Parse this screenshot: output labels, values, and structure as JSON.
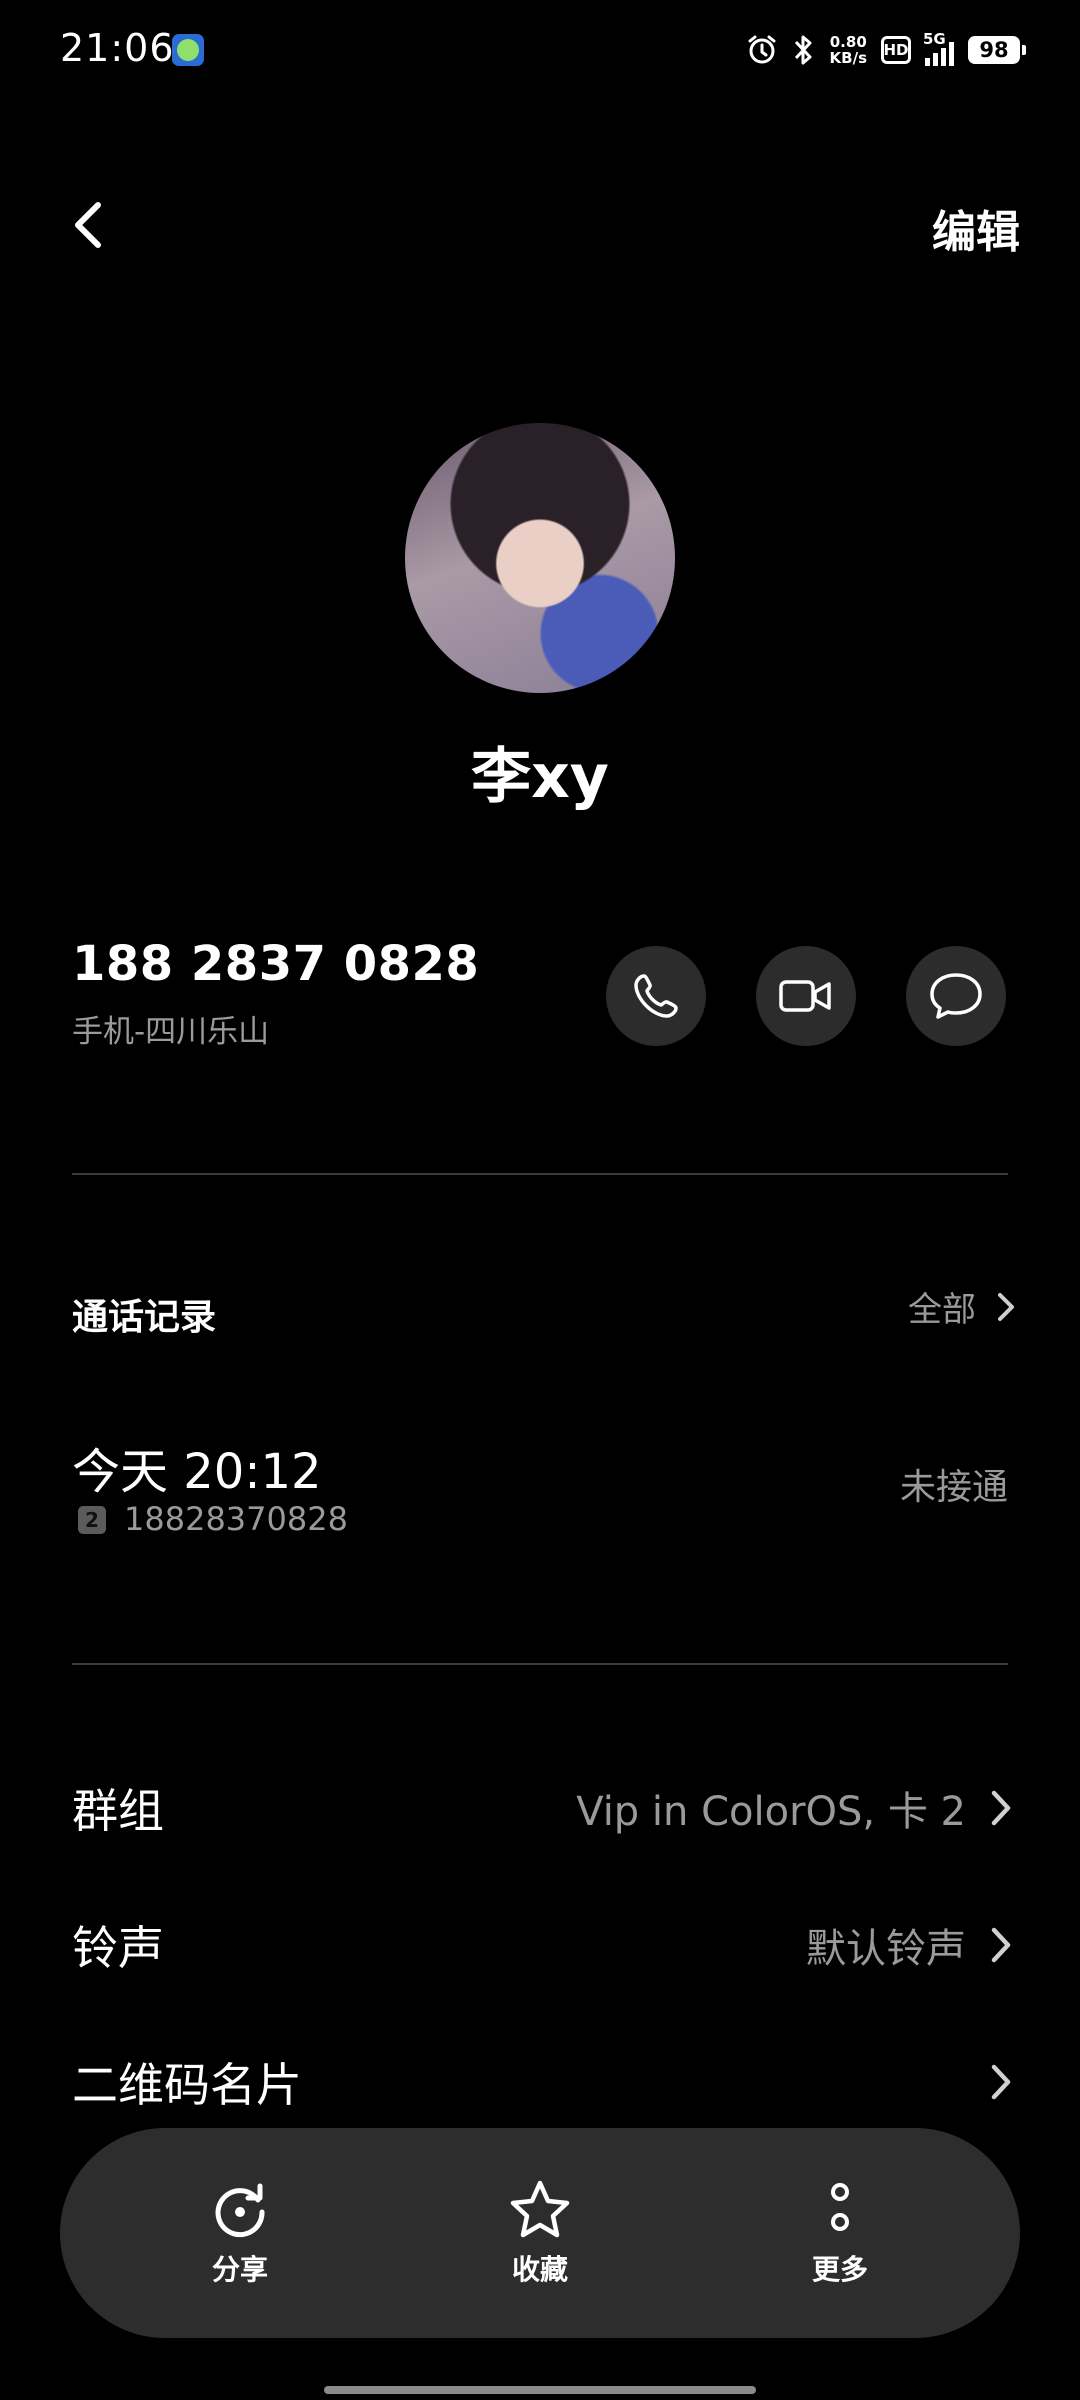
{
  "status_bar": {
    "time": "21:06",
    "net_speed_value": "0.80",
    "net_speed_unit": "KB/s",
    "hd": "HD",
    "network": "5G",
    "battery": "98"
  },
  "header": {
    "edit_label": "编辑"
  },
  "contact": {
    "name": "李xy",
    "phone": "188 2837 0828",
    "phone_label": "手机-四川乐山"
  },
  "call_log": {
    "title": "通话记录",
    "all_label": "全部",
    "entries": [
      {
        "time": "今天 20:12",
        "sim": "2",
        "number": "18828370828",
        "status": "未接通"
      }
    ]
  },
  "settings": {
    "group_label": "群组",
    "group_value": "Vip in ColorOS, 卡 2",
    "ringtone_label": "铃声",
    "ringtone_value": "默认铃声",
    "qr_label": "二维码名片"
  },
  "bottom_bar": {
    "share": "分享",
    "favorite": "收藏",
    "more": "更多"
  },
  "icons": {
    "back": "chevron-left-icon",
    "call": "phone-icon",
    "video": "video-camera-icon",
    "message": "chat-bubble-icon",
    "share": "share-refresh-icon",
    "favorite": "star-icon",
    "more": "vertical-dots-icon"
  }
}
